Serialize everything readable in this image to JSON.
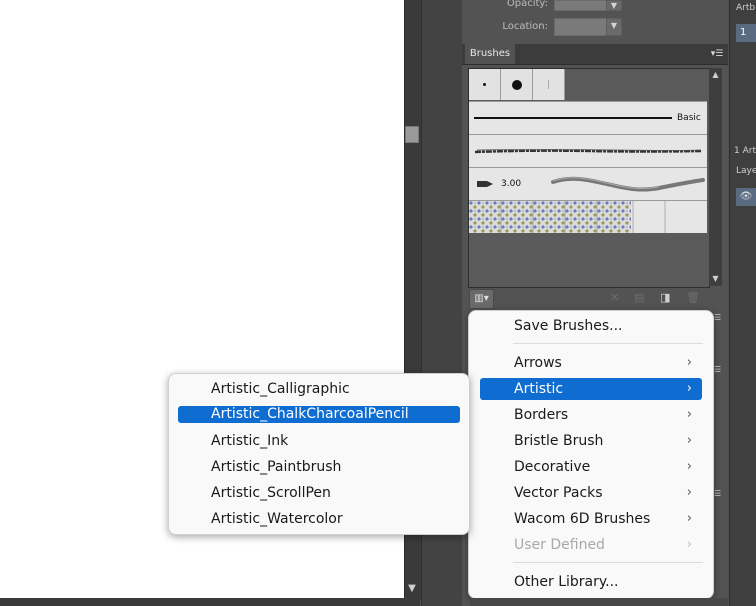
{
  "transparency": {
    "opacity_label": "Opacity:",
    "location_label": "Location:"
  },
  "brushes_panel": {
    "tab_label": "Brushes",
    "basic_label": "Basic",
    "stroke_size": "3.00",
    "library_icon": "brush-libraries-icon",
    "menu_icon": "panel-menu-icon"
  },
  "right_panel": {
    "artboards_label": "Artb",
    "artboard_number": "1",
    "artboards_count": "1 Art",
    "layers_label": "Laye"
  },
  "libraries_menu": {
    "save": "Save Brushes...",
    "items": [
      {
        "label": "Arrows",
        "selected": false,
        "disabled": false
      },
      {
        "label": "Artistic",
        "selected": true,
        "disabled": false
      },
      {
        "label": "Borders",
        "selected": false,
        "disabled": false
      },
      {
        "label": "Bristle Brush",
        "selected": false,
        "disabled": false
      },
      {
        "label": "Decorative",
        "selected": false,
        "disabled": false
      },
      {
        "label": "Vector Packs",
        "selected": false,
        "disabled": false
      },
      {
        "label": "Wacom 6D Brushes",
        "selected": false,
        "disabled": false
      },
      {
        "label": "User Defined",
        "selected": false,
        "disabled": true
      }
    ],
    "other": "Other Library..."
  },
  "artistic_submenu": {
    "items": [
      {
        "label": "Artistic_Calligraphic",
        "selected": false
      },
      {
        "label": "Artistic_ChalkCharcoalPencil",
        "selected": true
      },
      {
        "label": "Artistic_Ink",
        "selected": false
      },
      {
        "label": "Artistic_Paintbrush",
        "selected": false
      },
      {
        "label": "Artistic_ScrollPen",
        "selected": false
      },
      {
        "label": "Artistic_Watercolor",
        "selected": false
      }
    ]
  }
}
